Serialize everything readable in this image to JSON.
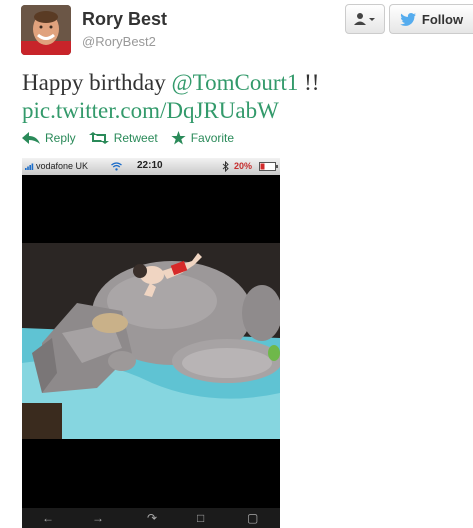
{
  "user": {
    "name": "Rory Best",
    "handle": "@RoryBest2"
  },
  "header_buttons": {
    "user_menu_icon": "user-dropdown-icon",
    "follow_label": "Follow"
  },
  "tweet": {
    "text_prefix": "Happy birthday ",
    "mention": "@TomCourt1",
    "text_suffix": " !!",
    "link": "pic.twitter.com/DqJRUabW"
  },
  "actions": {
    "reply": "Reply",
    "retweet": "Retweet",
    "favorite": "Favorite"
  },
  "phone_status": {
    "carrier": "vodafone UK",
    "time": "22:10",
    "battery": "20%"
  },
  "colors": {
    "link": "#339a6b",
    "follow_bird": "#55acee"
  }
}
